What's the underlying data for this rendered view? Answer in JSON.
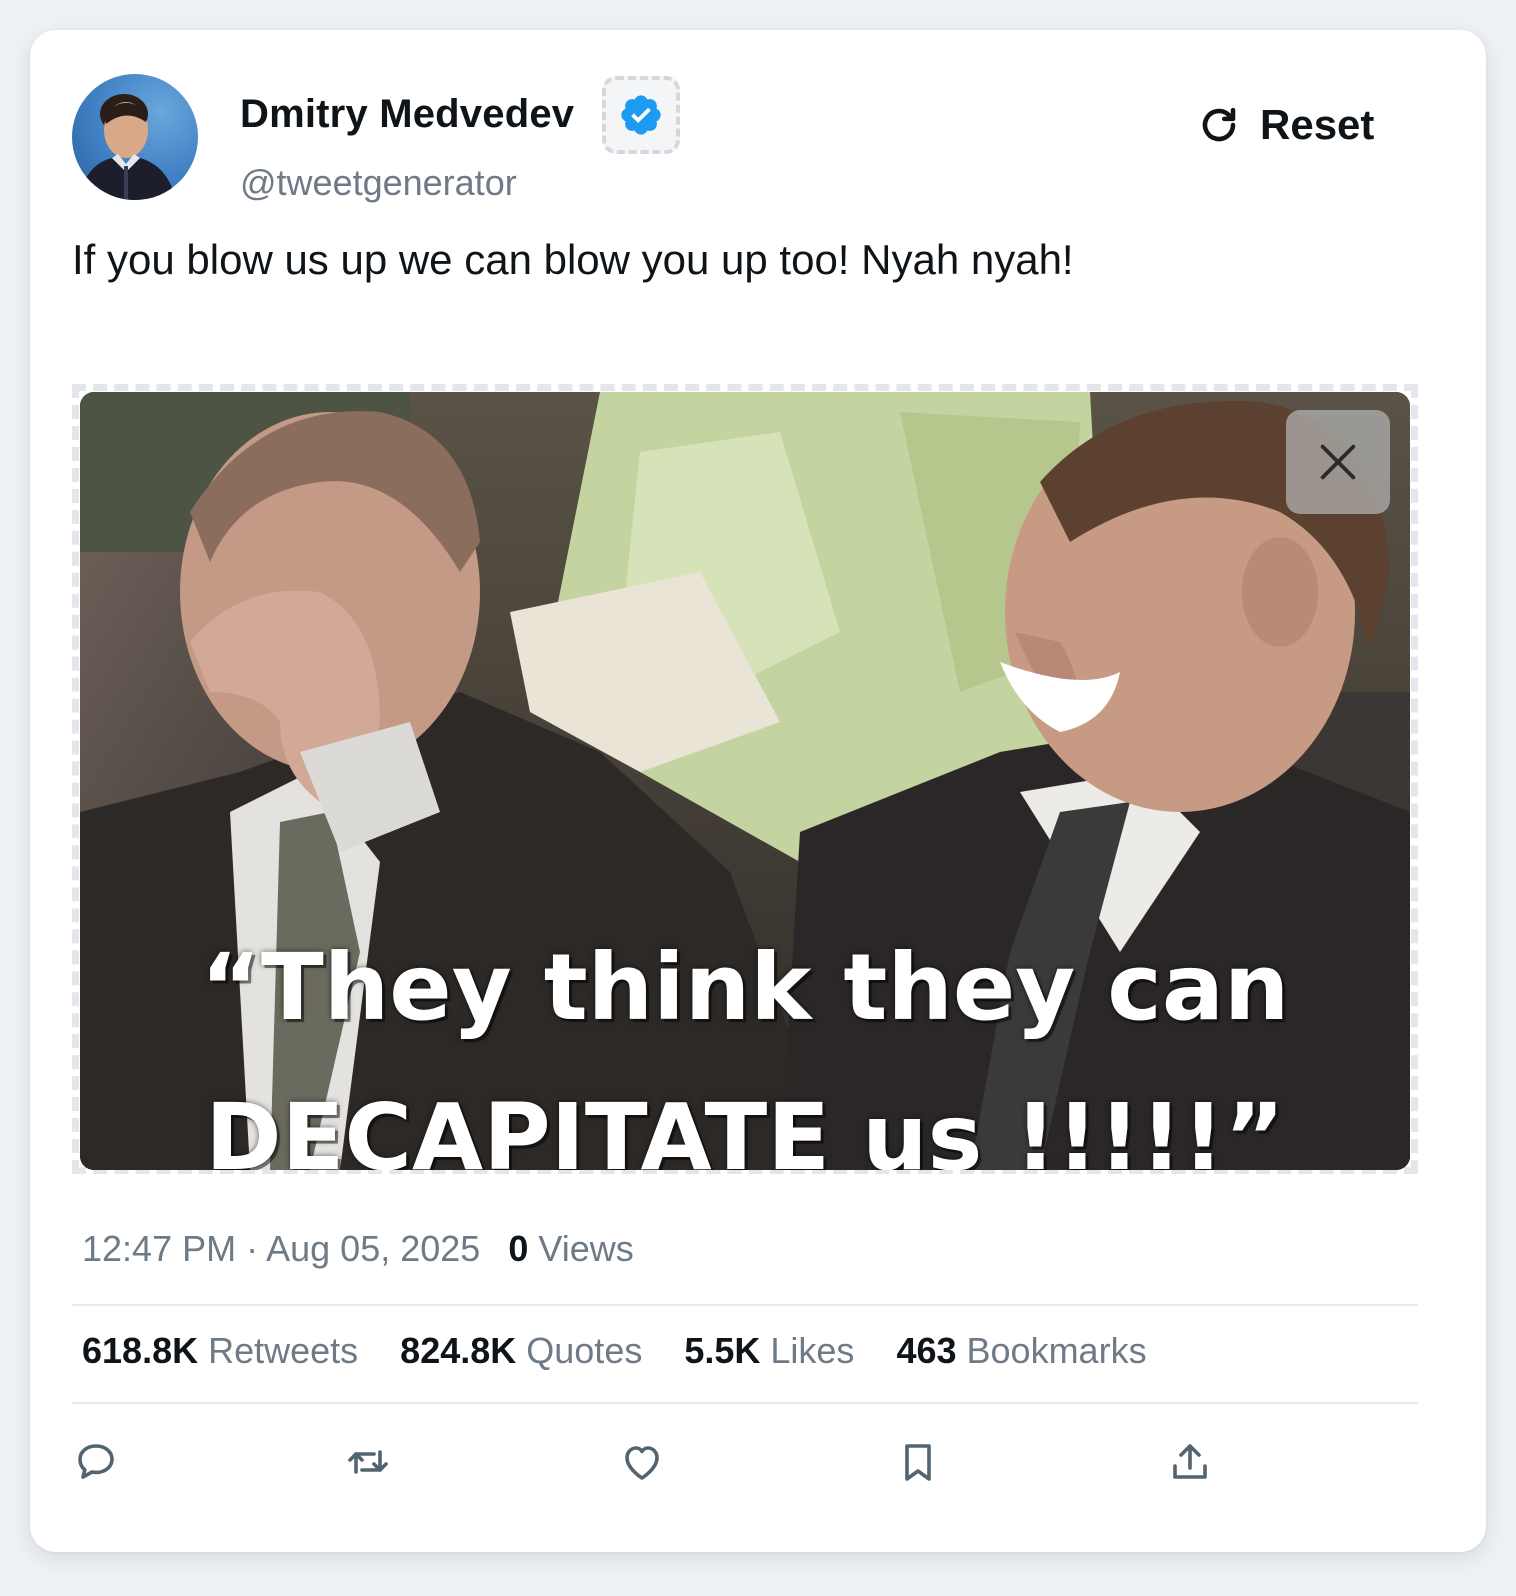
{
  "user": {
    "name": "Dmitry Medvedev",
    "handle": "@tweetgenerator",
    "verified": true
  },
  "header": {
    "reset_label": "Reset"
  },
  "tweet": {
    "text": "If you blow us up we can blow you up too! Nyah nyah!",
    "image_caption_line1": "“They think they can",
    "image_caption_line2": "DECAPITATE us !!!!!”"
  },
  "meta": {
    "time": "12:47 PM",
    "separator": "·",
    "date": "Aug 05, 2025",
    "views_count": "0",
    "views_label": "Views"
  },
  "stats": [
    {
      "count": "618.8K",
      "label": "Retweets"
    },
    {
      "count": "824.8K",
      "label": "Quotes"
    },
    {
      "count": "5.5K",
      "label": "Likes"
    },
    {
      "count": "463",
      "label": "Bookmarks"
    }
  ],
  "actions": [
    "reply-icon",
    "retweet-icon",
    "like-icon",
    "bookmark-icon",
    "share-icon"
  ],
  "colors": {
    "verified_blue": "#1d9bf0",
    "text_primary": "#0f1419",
    "text_secondary": "#6e7a86",
    "background": "#eef1f5"
  }
}
